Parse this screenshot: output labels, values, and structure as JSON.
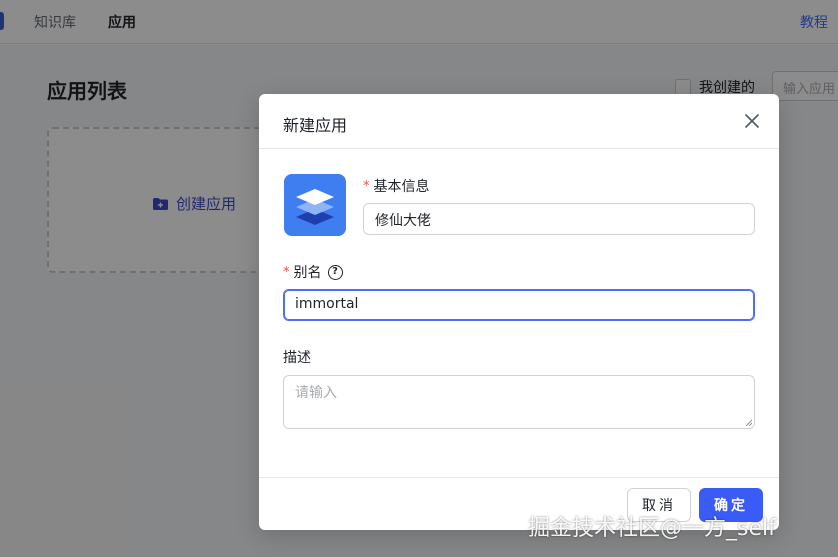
{
  "nav": {
    "items": [
      {
        "label": "知识库"
      },
      {
        "label": "应用"
      }
    ],
    "tutorial_label": "教程"
  },
  "page": {
    "title": "应用列表",
    "filter_mine_label": "我创建的",
    "search_placeholder": "输入应用",
    "create_card_label": "创建应用"
  },
  "dialog": {
    "title": "新建应用",
    "basic_info_label": "基本信息",
    "name_value": "修仙大佬",
    "alias_label": "别名",
    "alias_value": "immortal",
    "description_label": "描述",
    "description_placeholder": "请输入",
    "required_mark": "*",
    "cancel_label": "取消",
    "ok_label": "确定"
  },
  "watermark": "掘金技术社区@一方_self",
  "colors": {
    "primary": "#3b5bf6",
    "app_icon_bg": "#3f7ef0",
    "required": "#f54a45"
  }
}
